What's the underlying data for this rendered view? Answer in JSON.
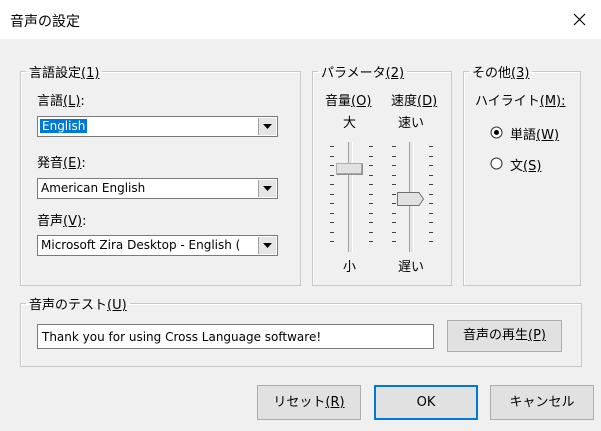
{
  "window": {
    "title": "音声の設定",
    "close_icon": "close-icon"
  },
  "language_settings": {
    "group_label": "言語設定",
    "group_mnemonic": "(1)",
    "language_label": "言語",
    "language_mnemonic": "(L)",
    "language_value": "English",
    "pronunciation_label": "発音",
    "pronunciation_mnemonic": "(E)",
    "pronunciation_value": "American English",
    "voice_label": "音声",
    "voice_mnemonic": "(V)",
    "voice_value": "Microsoft Zira Desktop - English ("
  },
  "parameters": {
    "group_label": "パラメータ",
    "group_mnemonic": "(2)",
    "volume_label": "音量",
    "volume_mnemonic": "(O)",
    "speed_label": "速度",
    "speed_mnemonic": "(D)",
    "volume_top": "大",
    "volume_bottom": "小",
    "speed_top": "速い",
    "speed_bottom": "遅い"
  },
  "other": {
    "group_label": "その他",
    "group_mnemonic": "(3)",
    "highlight_label": "ハイライト",
    "highlight_mnemonic": "(M):",
    "options": [
      {
        "label": "単語",
        "mnemonic": "(W)",
        "selected": true
      },
      {
        "label": "文",
        "mnemonic": "(S)",
        "selected": false
      }
    ]
  },
  "voice_test": {
    "group_label": "音声のテスト",
    "group_mnemonic": "(U)",
    "text": "Thank you for using Cross Language software!",
    "play_label": "音声の再生",
    "play_mnemonic": "(P)"
  },
  "footer": {
    "reset_label": "リセット",
    "reset_mnemonic": "(R)",
    "ok_label": "OK",
    "cancel_label": "キャンセル"
  },
  "colors": {
    "accent": "#0078d7",
    "background": "#f0f0f0"
  }
}
